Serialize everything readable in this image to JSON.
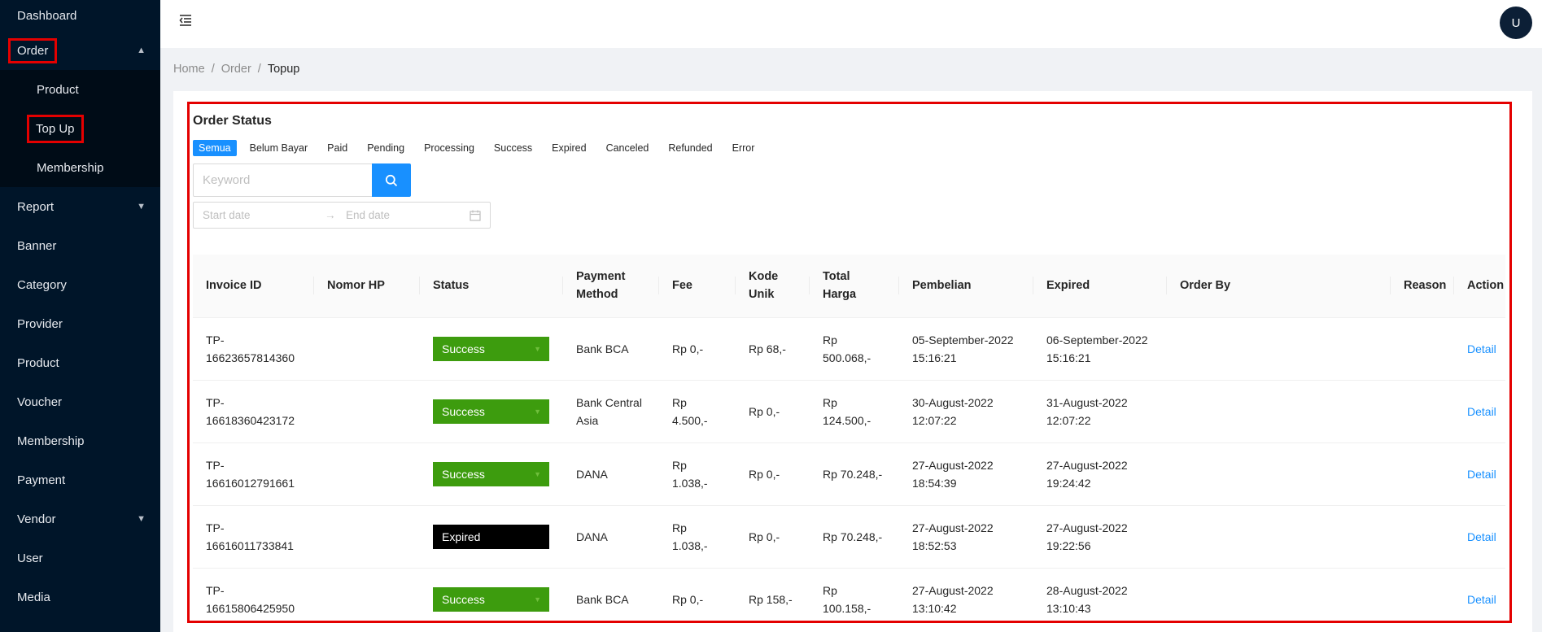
{
  "sidebar": {
    "dashboard": "Dashboard",
    "order": "Order",
    "order_sub": [
      "Product",
      "Top Up",
      "Membership"
    ],
    "items": [
      "Report",
      "Banner",
      "Category",
      "Provider",
      "Product",
      "Voucher",
      "Membership",
      "Payment",
      "Vendor",
      "User",
      "Media"
    ]
  },
  "header": {
    "avatar_initial": "U"
  },
  "breadcrumb": {
    "home": "Home",
    "order": "Order",
    "current": "Topup",
    "separator": "/"
  },
  "card": {
    "title": "Order Status",
    "tabs": [
      "Semua",
      "Belum Bayar",
      "Paid",
      "Pending",
      "Processing",
      "Success",
      "Expired",
      "Canceled",
      "Refunded",
      "Error"
    ],
    "search_placeholder": "Keyword",
    "start_placeholder": "Start date",
    "end_placeholder": "End date",
    "range_arrow": "→"
  },
  "table": {
    "headers": [
      "Invoice ID",
      "Nomor HP",
      "Status",
      "Payment Method",
      "Fee",
      "Kode Unik",
      "Total Harga",
      "Pembelian",
      "Expired",
      "Order By",
      "Reason",
      "Action"
    ],
    "rows": [
      {
        "invoice": "TP-16623657814360",
        "phone": "",
        "status": "Success",
        "payment": "Bank BCA",
        "fee": "Rp 0,-",
        "kode": "Rp 68,-",
        "total": "Rp 500.068,-",
        "pembelian": "05-September-2022 15:16:21",
        "expired": "06-September-2022 15:16:21",
        "order_by": "",
        "reason": "",
        "action": "Detail"
      },
      {
        "invoice": "TP-16618360423172",
        "phone": "",
        "status": "Success",
        "payment": "Bank Central Asia",
        "fee": "Rp 4.500,-",
        "kode": "Rp 0,-",
        "total": "Rp 124.500,-",
        "pembelian": "30-August-2022 12:07:22",
        "expired": "31-August-2022 12:07:22",
        "order_by": "",
        "reason": "",
        "action": "Detail"
      },
      {
        "invoice": "TP-16616012791661",
        "phone": "",
        "status": "Success",
        "payment": "DANA",
        "fee": "Rp 1.038,-",
        "kode": "Rp 0,-",
        "total": "Rp 70.248,-",
        "pembelian": "27-August-2022 18:54:39",
        "expired": "27-August-2022 19:24:42",
        "order_by": "",
        "reason": "",
        "action": "Detail"
      },
      {
        "invoice": "TP-16616011733841",
        "phone": "",
        "status": "Expired",
        "payment": "DANA",
        "fee": "Rp 1.038,-",
        "kode": "Rp 0,-",
        "total": "Rp 70.248,-",
        "pembelian": "27-August-2022 18:52:53",
        "expired": "27-August-2022 19:22:56",
        "order_by": "",
        "reason": "",
        "action": "Detail"
      },
      {
        "invoice": "TP-16615806425950",
        "phone": "",
        "status": "Success",
        "payment": "Bank BCA",
        "fee": "Rp 0,-",
        "kode": "Rp 158,-",
        "total": "Rp 100.158,-",
        "pembelian": "27-August-2022 13:10:42",
        "expired": "28-August-2022 13:10:43",
        "order_by": "",
        "reason": "",
        "action": "Detail"
      }
    ]
  },
  "colors": {
    "sidebar": "#001529",
    "submenu": "#000c17",
    "primary": "#1890ff",
    "success": "#3d9c0e",
    "expired": "#000000",
    "highlight": "#e40000"
  }
}
